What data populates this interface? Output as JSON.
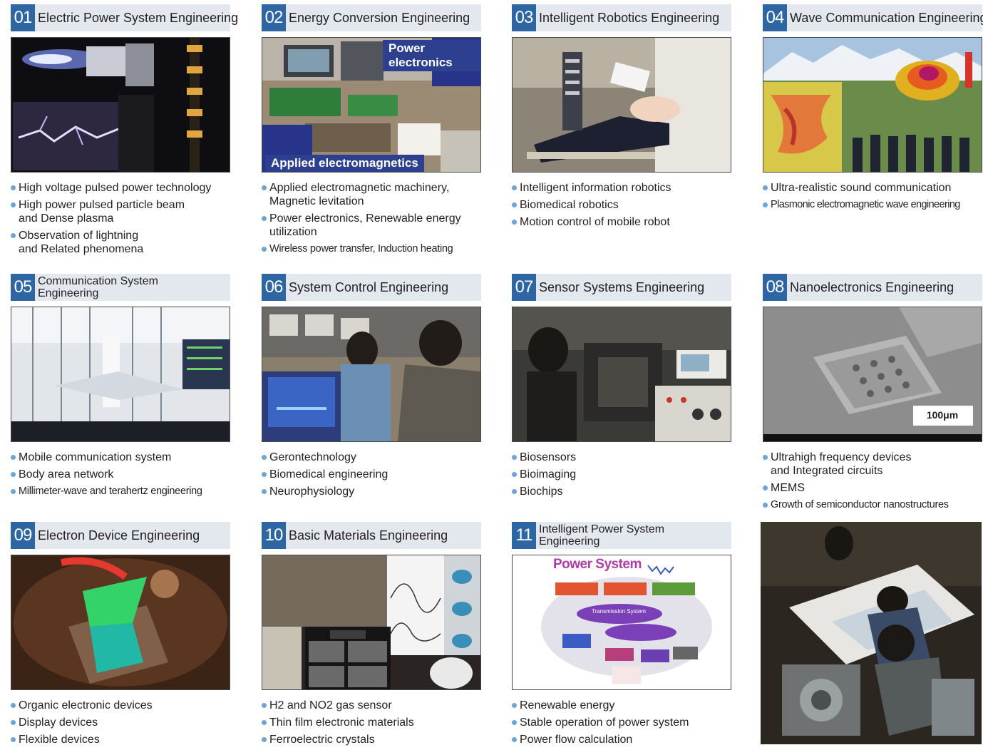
{
  "cards": [
    {
      "num": "01",
      "title": "Electric Power System Engineering",
      "items": [
        "High voltage pulsed power technology",
        "High power pulsed particle beam\nand Dense plasma",
        "Observation of lightning\nand Related phenomena"
      ]
    },
    {
      "num": "02",
      "title": "Energy Conversion Engineering",
      "tags": [
        "Power electronics",
        "Applied electromagnetics"
      ],
      "items": [
        "Applied electromagnetic machinery,\nMagnetic levitation",
        "Power electronics, Renewable energy\nutilization",
        "Wireless power transfer, Induction heating"
      ]
    },
    {
      "num": "03",
      "title": "Intelligent Robotics Engineering",
      "items": [
        "Intelligent information robotics",
        "Biomedical robotics",
        "Motion control of mobile robot"
      ]
    },
    {
      "num": "04",
      "title": "Wave Communication Engineering",
      "items": [
        "Ultra-realistic sound communication",
        "Plasmonic electromagnetic wave engineering"
      ]
    },
    {
      "num": "05",
      "title": "Communication System\nEngineering",
      "items": [
        "Mobile communication system",
        "Body area network",
        "Millimeter-wave and terahertz engineering"
      ]
    },
    {
      "num": "06",
      "title": "System Control Engineering",
      "items": [
        "Gerontechnology",
        "Biomedical engineering",
        "Neurophysiology"
      ]
    },
    {
      "num": "07",
      "title": "Sensor Systems Engineering",
      "items": [
        "Biosensors",
        "Bioimaging",
        "Biochips"
      ]
    },
    {
      "num": "08",
      "title": "Nanoelectronics Engineering",
      "scale": "100μm",
      "items": [
        "Ultrahigh frequency devices\nand Integrated circuits",
        "MEMS",
        "Growth of semiconductor nanostructures"
      ]
    },
    {
      "num": "09",
      "title": "Electron Device Engineering",
      "items": [
        "Organic electronic devices",
        "Display devices",
        "Flexible devices"
      ]
    },
    {
      "num": "10",
      "title": "Basic Materials Engineering",
      "items": [
        "H2 and NO2 gas sensor",
        "Thin film electronic materials",
        "Ferroelectric crystals"
      ]
    },
    {
      "num": "11",
      "title": "Intelligent Power System\nEngineering",
      "diagram": {
        "heading": "Power System",
        "center": "Transmission System"
      },
      "items": [
        "Renewable energy",
        "Stable operation of power system",
        "Power flow calculation"
      ]
    }
  ]
}
